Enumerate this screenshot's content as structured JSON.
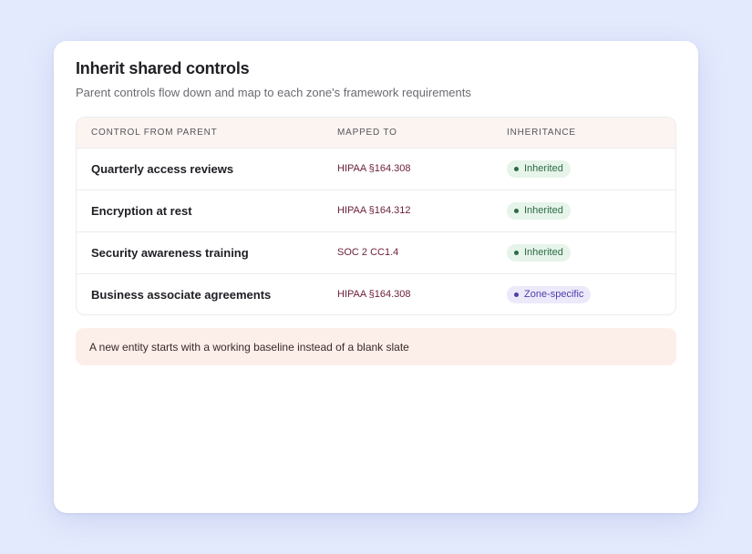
{
  "card": {
    "title": "Inherit shared controls",
    "subtitle": "Parent controls flow down and map to each zone's framework requirements"
  },
  "table": {
    "columns": [
      "CONTROL FROM PARENT",
      "MAPPED TO",
      "INHERITANCE"
    ],
    "rows": [
      {
        "control": "Quarterly access reviews",
        "mapped_to": "HIPAA §164.308",
        "inheritance": "Inherited",
        "status": "inherited"
      },
      {
        "control": "Encryption at rest",
        "mapped_to": "HIPAA §164.312",
        "inheritance": "Inherited",
        "status": "inherited"
      },
      {
        "control": "Security awareness training",
        "mapped_to": "SOC 2 CC1.4",
        "inheritance": "Inherited",
        "status": "inherited"
      },
      {
        "control": "Business associate agreements",
        "mapped_to": "HIPAA §164.308",
        "inheritance": "Zone-specific",
        "status": "zone"
      }
    ]
  },
  "note": {
    "text": "A new entity starts with a working baseline instead of a blank slate"
  },
  "colors": {
    "background": "#e4eafd",
    "inherited": "#2c6b45",
    "zone_specific": "#4e3fa8",
    "mapping_text": "#6b1d3a"
  }
}
